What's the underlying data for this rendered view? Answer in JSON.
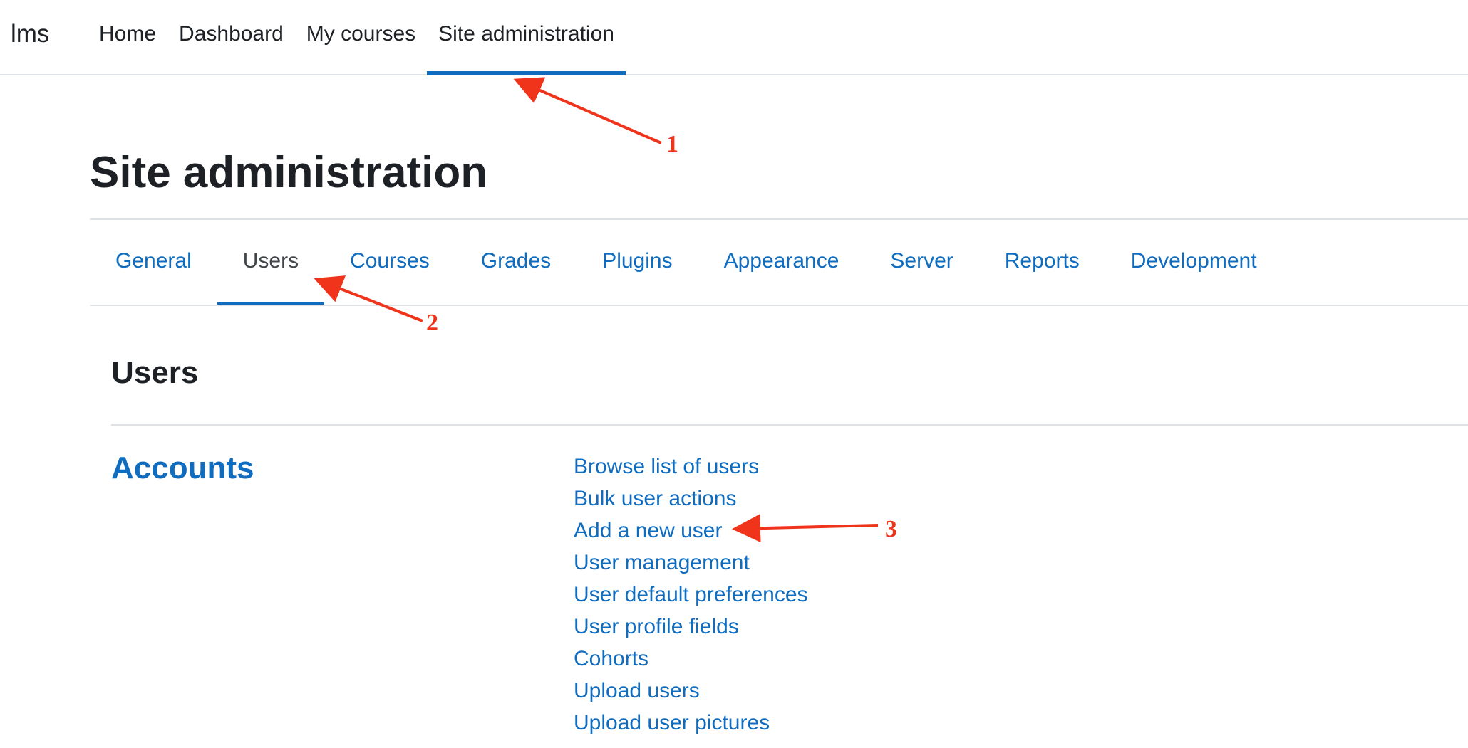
{
  "navbar": {
    "brand": "lms",
    "items": [
      {
        "label": "Home",
        "active": false
      },
      {
        "label": "Dashboard",
        "active": false
      },
      {
        "label": "My courses",
        "active": false
      },
      {
        "label": "Site administration",
        "active": true
      }
    ]
  },
  "page": {
    "title": "Site administration"
  },
  "tabs": [
    {
      "label": "General",
      "active": false
    },
    {
      "label": "Users",
      "active": true
    },
    {
      "label": "Courses",
      "active": false
    },
    {
      "label": "Grades",
      "active": false
    },
    {
      "label": "Plugins",
      "active": false
    },
    {
      "label": "Appearance",
      "active": false
    },
    {
      "label": "Server",
      "active": false
    },
    {
      "label": "Reports",
      "active": false
    },
    {
      "label": "Development",
      "active": false
    }
  ],
  "section": {
    "heading": "Users",
    "category": {
      "title": "Accounts",
      "links": [
        "Browse list of users",
        "Bulk user actions",
        "Add a new user",
        "User management",
        "User default preferences",
        "User profile fields",
        "Cohorts",
        "Upload users",
        "Upload user pictures"
      ]
    }
  },
  "annotations": {
    "color": "#f0341c",
    "labels": [
      "1",
      "2",
      "3"
    ]
  },
  "colors": {
    "link": "#0f6cbf",
    "text": "#1d2125",
    "divider": "#dee2e6"
  }
}
